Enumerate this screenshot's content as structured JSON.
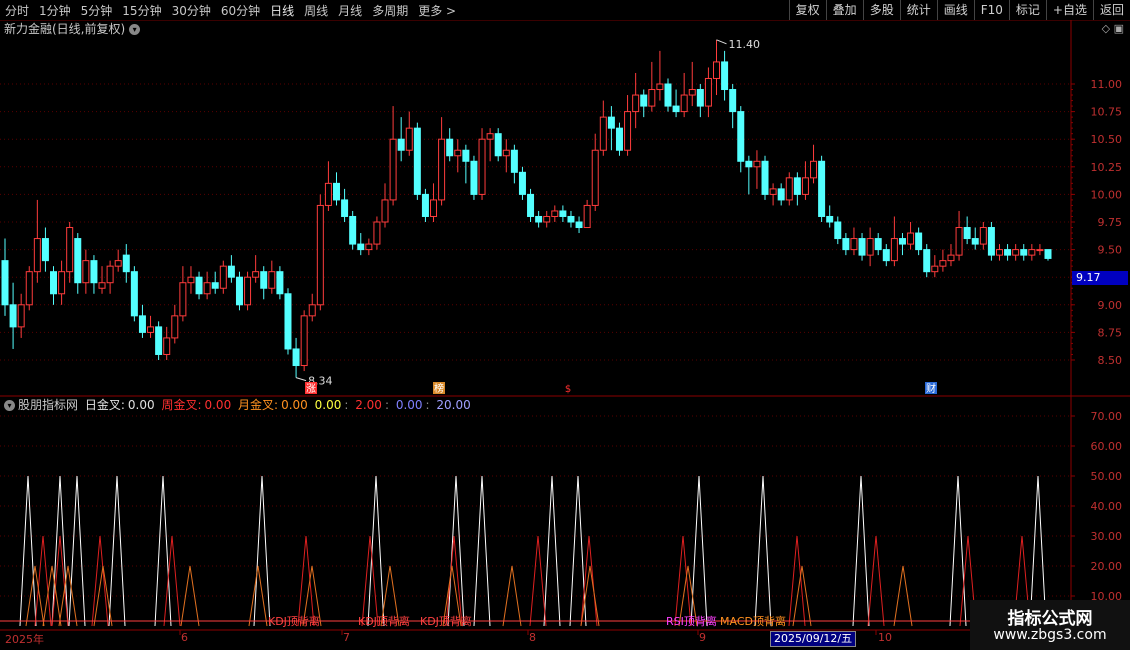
{
  "toolbar": {
    "timeframes": [
      "分时",
      "1分钟",
      "5分钟",
      "15分钟",
      "30分钟",
      "60分钟",
      "日线",
      "周线",
      "月线",
      "多周期",
      "更多 >"
    ],
    "active": "日线",
    "tools": [
      "复权",
      "叠加",
      "多股",
      "统计",
      "画线",
      "F10",
      "标记",
      "+自选",
      "返回"
    ]
  },
  "stock_title": "新力金融(日线,前复权)",
  "price_axis": [
    "11.00",
    "10.75",
    "10.50",
    "10.25",
    "10.00",
    "9.75",
    "9.50",
    "9.25",
    "9.00",
    "8.75",
    "8.50"
  ],
  "current_price": "9.17",
  "high_label": "11.40",
  "low_label": "8.34",
  "event_badges": [
    "涨",
    "榜",
    "$",
    "财"
  ],
  "indicator": {
    "name": "股朋指标网",
    "items": [
      {
        "label": "日金叉:",
        "value": "0.00",
        "color": "#e0e0e0"
      },
      {
        "label": "周金叉:",
        "value": "0.00",
        "color": "#ff3030"
      },
      {
        "label": "月金叉:",
        "value": "0.00",
        "color": "#ff9020"
      }
    ],
    "extra_values": [
      {
        "value": "0.00",
        "color": "#ffff40"
      },
      {
        "value": "2.00",
        "color": "#ff3030"
      },
      {
        "value": "0.00",
        "color": "#8080ff"
      },
      {
        "value": "20.00",
        "color": "#a0a0ff"
      }
    ],
    "axis": [
      "70.00",
      "60.00",
      "50.00",
      "40.00",
      "30.00",
      "20.00",
      "10.00"
    ],
    "signals": [
      "KDJ顶背离",
      "KDJ顶背离",
      "KDJ顶背离",
      "RSI顶背离",
      "MACD顶背离"
    ]
  },
  "x_axis": [
    "2025年",
    "6",
    "7",
    "8",
    "9",
    "10"
  ],
  "selected_date": "2025/09/12/五",
  "watermark": {
    "title": "指标公式网",
    "url": "www.zbgs3.com"
  },
  "colors": {
    "up": "#ff3c3c",
    "down": "#54ffff",
    "grid": "#5a0000",
    "axis": "#8b0000"
  }
}
